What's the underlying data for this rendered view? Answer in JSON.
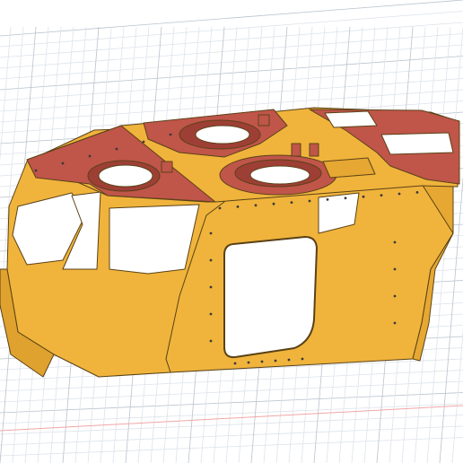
{
  "viewport": {
    "background": "#ffffff",
    "grid_minor_color": "#dde3ea",
    "grid_major_color": "#b9c3ce",
    "axis_color": "#f2a6a6"
  },
  "model": {
    "body_color": "#f0b43c",
    "body_shade": "#d99a26",
    "body_dark": "#b67d18",
    "roof_panel_color": "#c0554a",
    "roof_panel_dark": "#9e3f36",
    "edge_color": "#5a4216",
    "hole_color": "#3a3a3a"
  }
}
